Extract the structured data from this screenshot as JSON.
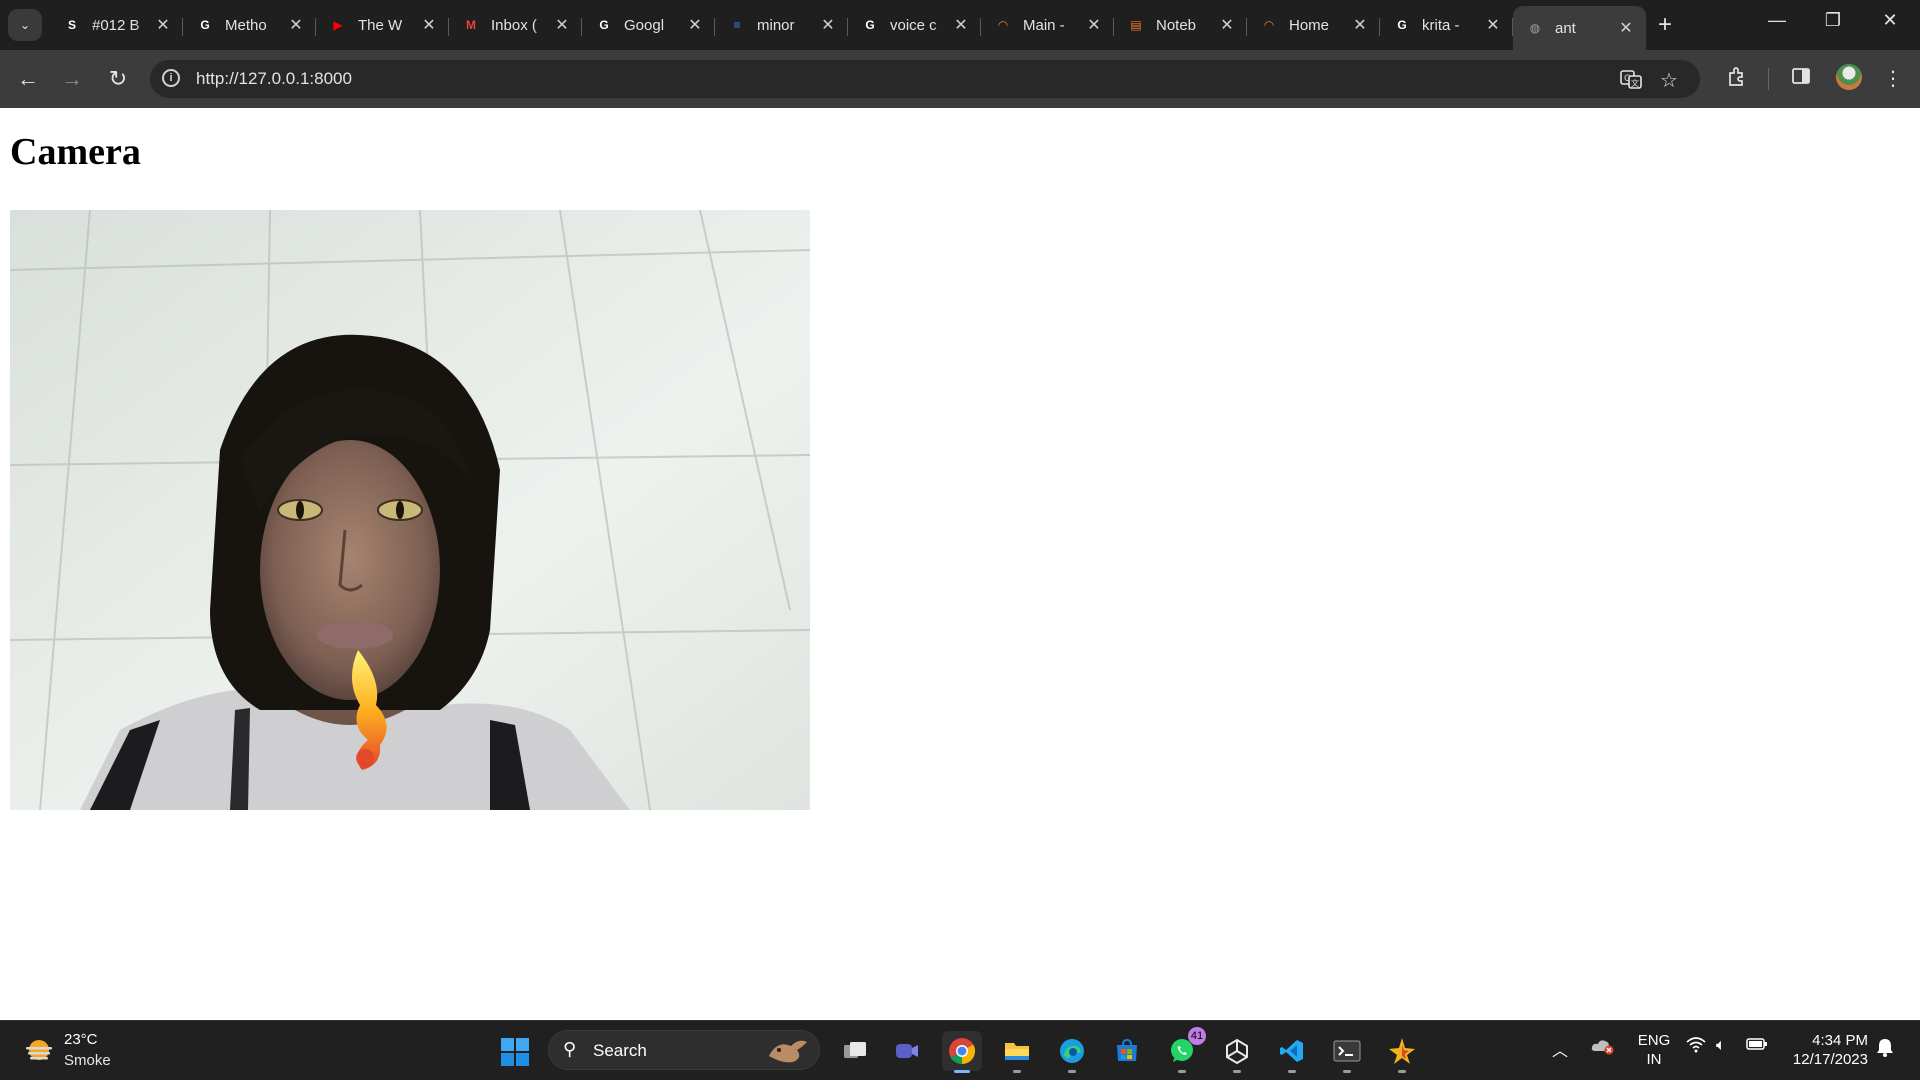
{
  "browser": {
    "tabs": [
      {
        "title": "#012 B",
        "favicon": "scribd-icon",
        "fav_color": "#ffffff",
        "fav_text": "S"
      },
      {
        "title": "Metho",
        "favicon": "google-icon",
        "fav_color": "#ffffff",
        "fav_text": "G"
      },
      {
        "title": "The W",
        "favicon": "youtube-icon",
        "fav_color": "#ff0000",
        "fav_text": "▶"
      },
      {
        "title": "Inbox (",
        "favicon": "gmail-icon",
        "fav_color": "#ea4335",
        "fav_text": "M"
      },
      {
        "title": "Googl",
        "favicon": "google-icon",
        "fav_color": "#ffffff",
        "fav_text": "G"
      },
      {
        "title": "minor",
        "favicon": "google-docs-icon",
        "fav_color": "#4285f4",
        "fav_text": "≡"
      },
      {
        "title": "voice c",
        "favicon": "google-icon",
        "fav_color": "#ffffff",
        "fav_text": "G"
      },
      {
        "title": "Main -",
        "favicon": "jupyter-icon",
        "fav_color": "#f37626",
        "fav_text": "◠"
      },
      {
        "title": "Noteb",
        "favicon": "notebook-icon",
        "fav_color": "#f37626",
        "fav_text": "▤"
      },
      {
        "title": "Home",
        "favicon": "jupyter-icon",
        "fav_color": "#f37626",
        "fav_text": "◠"
      },
      {
        "title": "krita -",
        "favicon": "google-icon",
        "fav_color": "#ffffff",
        "fav_text": "G"
      },
      {
        "title": "ant",
        "favicon": "globe-icon",
        "fav_color": "#9aa0a6",
        "fav_text": "◍",
        "active": true
      }
    ],
    "url": "http://127.0.0.1:8000"
  },
  "page": {
    "heading": "Camera",
    "camera_feed": {
      "overlays": [
        "cat-eyes-filter",
        "fire-breath-filter"
      ]
    }
  },
  "taskbar": {
    "weather": {
      "temp": "23°C",
      "desc": "Smoke"
    },
    "search_label": "Search",
    "apps": [
      {
        "name": "task-view-icon"
      },
      {
        "name": "teams-meet-icon"
      },
      {
        "name": "chrome-icon",
        "active": true
      },
      {
        "name": "file-explorer-icon"
      },
      {
        "name": "edge-icon"
      },
      {
        "name": "microsoft-store-icon"
      },
      {
        "name": "whatsapp-icon",
        "badge": "41"
      },
      {
        "name": "unity-icon"
      },
      {
        "name": "vscode-icon"
      },
      {
        "name": "terminal-icon"
      },
      {
        "name": "ai-sparkle-icon"
      }
    ],
    "lang_line1": "ENG",
    "lang_line2": "IN",
    "time": "4:34 PM",
    "date": "12/17/2023"
  },
  "colors": {
    "tabstrip": "#1f1f1f",
    "toolbar": "#3c3c3c",
    "taskbar": "#202020",
    "accent": "#7db3ff"
  }
}
